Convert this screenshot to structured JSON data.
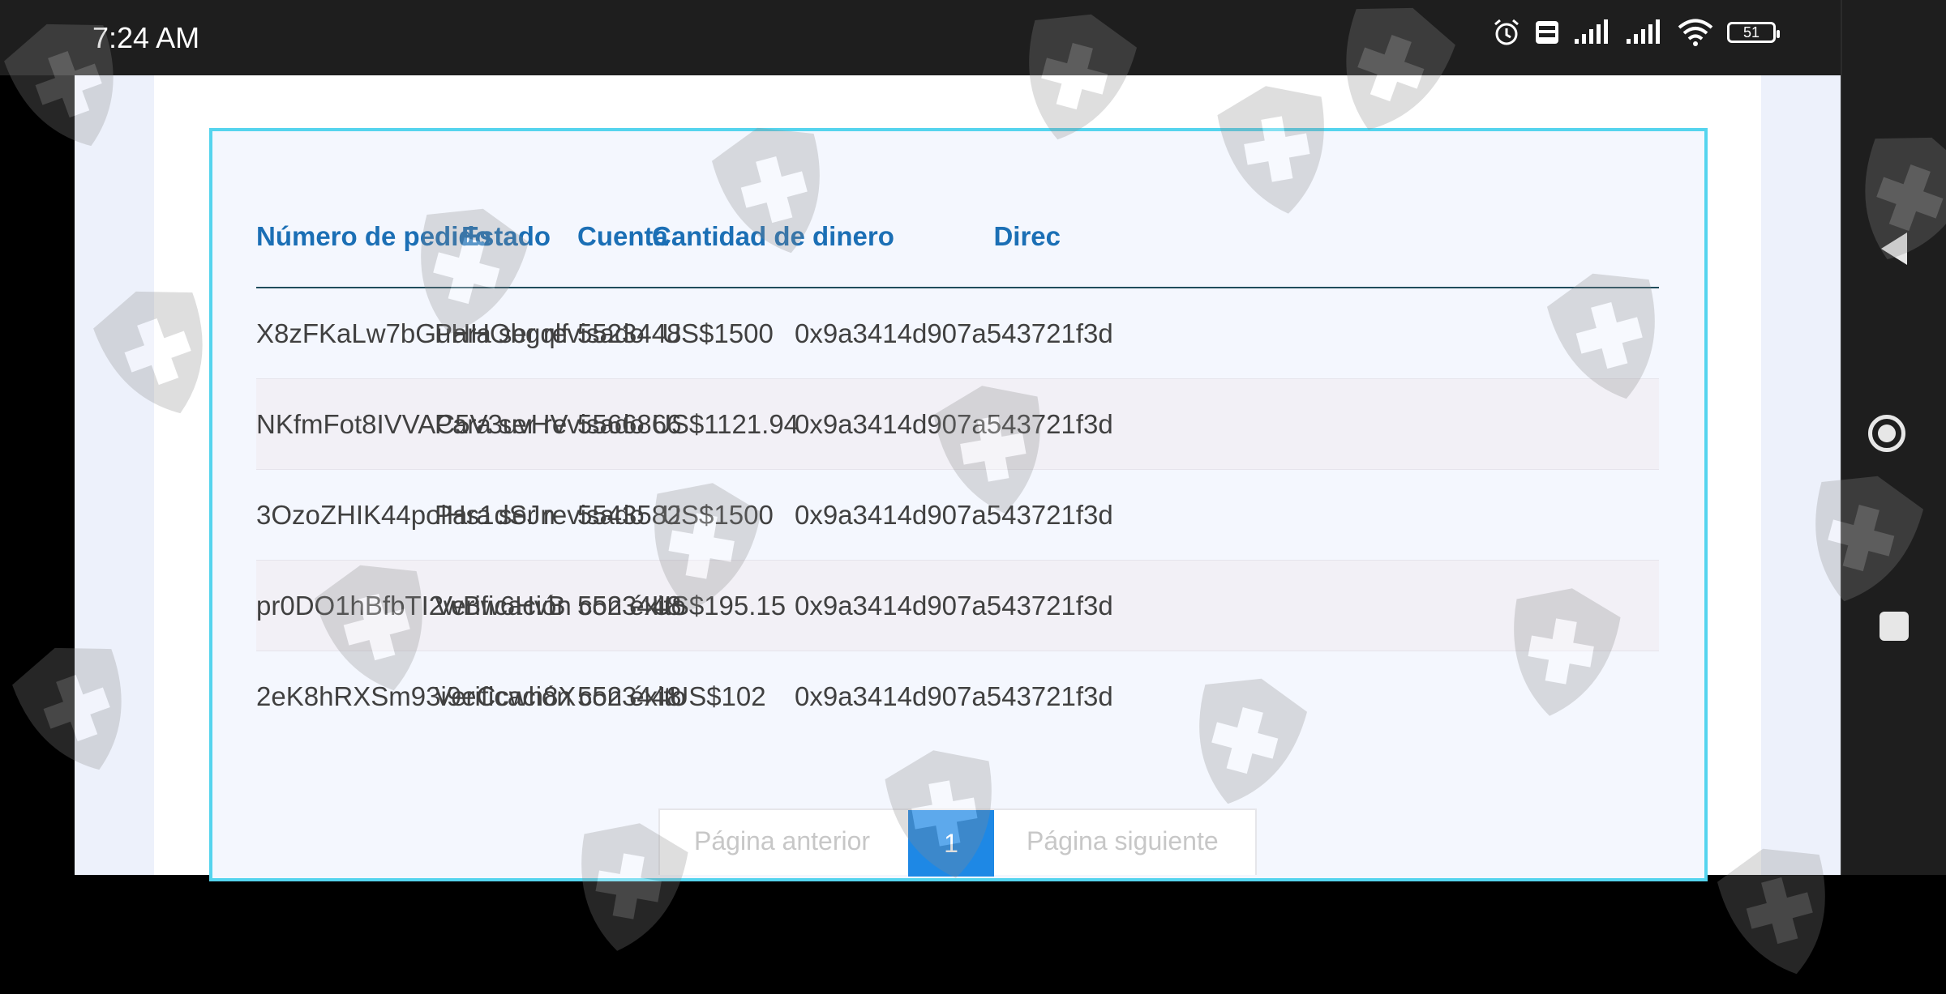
{
  "status_bar": {
    "time": "7:24 AM",
    "battery": "51"
  },
  "table": {
    "headers": [
      "Número de pedido",
      "Estado",
      "Cuenta",
      "Cantidad de dinero",
      "Direc"
    ],
    "rows": [
      [
        "X8zFKaLw7bGuHHObgqlf",
        "Para ser revisado",
        "5523448",
        "US$1500",
        "0x9a3414d907a543721f3d"
      ],
      [
        "NKfmFot8IVVAC5V3uvHV",
        "Para ser revisado",
        "5566866",
        "US$1121.94",
        "0x9a3414d907a543721f3d"
      ],
      [
        "3OzoZHIK44polHs1dSJn",
        "Para ser revisado",
        "5543582",
        "US$1500",
        "0x9a3414d907a543721f3d"
      ],
      [
        "pr0DO1hBfbTI2wBw6HvB",
        "Verificación con éxito",
        "5523448",
        "US$195.15",
        "0x9a3414d907a543721f3d"
      ],
      [
        "2eK8hRXSm93i9eCcwh8X",
        "Verificación con éxito",
        "5523448",
        "US$102",
        "0x9a3414d907a543721f3d"
      ]
    ]
  },
  "pagination": {
    "prev_label": "Página anterior",
    "current_page": "1",
    "next_label": "Página siguiente"
  },
  "colors": {
    "header_text": "#1b6fb5",
    "card_border": "#55d4ee",
    "active_page": "#1e88e5"
  },
  "icons": [
    "alarm-icon",
    "volte-icon",
    "signal-icon",
    "wifi-icon",
    "battery-icon",
    "back-icon",
    "home-icon",
    "recents-icon",
    "watermark-shield-icon"
  ]
}
